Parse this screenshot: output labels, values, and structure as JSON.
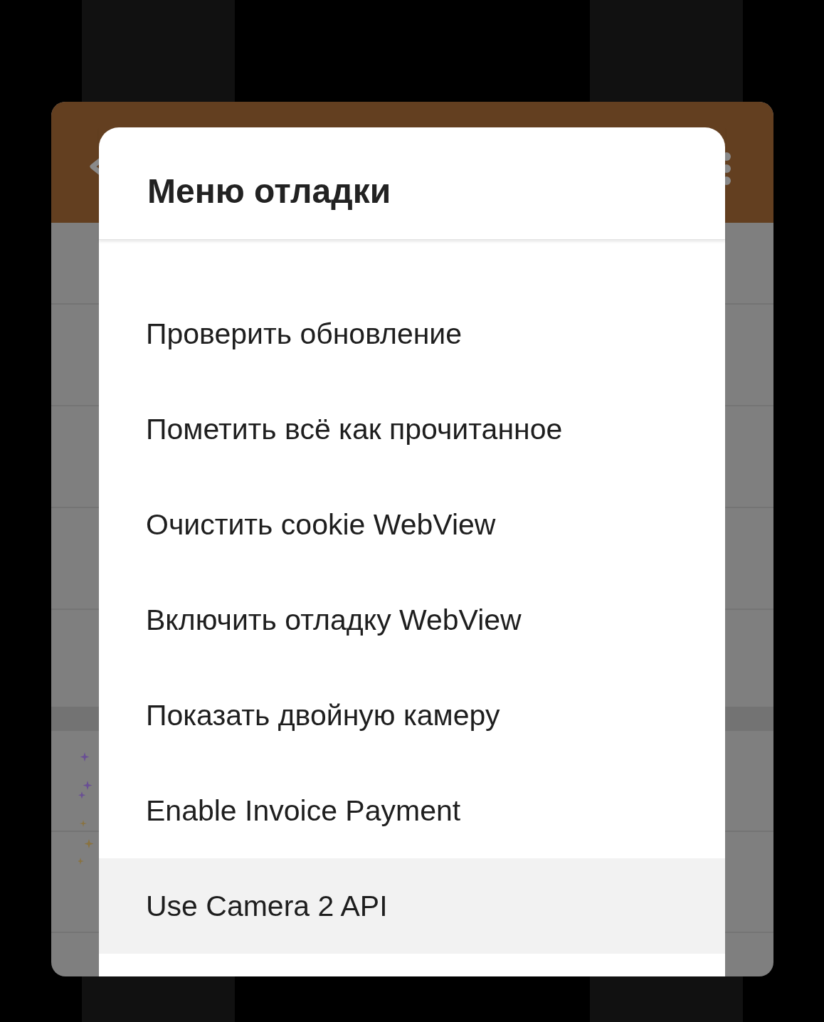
{
  "dialog": {
    "title": "Меню отладки",
    "items": [
      {
        "label": "Проверить обновление",
        "selected": false
      },
      {
        "label": "Пометить всё как прочитанное",
        "selected": false
      },
      {
        "label": "Очистить cookie WebView",
        "selected": false
      },
      {
        "label": "Включить отладку WebView",
        "selected": false
      },
      {
        "label": "Показать двойную камеру",
        "selected": false
      },
      {
        "label": "Enable Invoice Payment",
        "selected": false
      },
      {
        "label": "Use Camera 2 API",
        "selected": true
      }
    ]
  }
}
